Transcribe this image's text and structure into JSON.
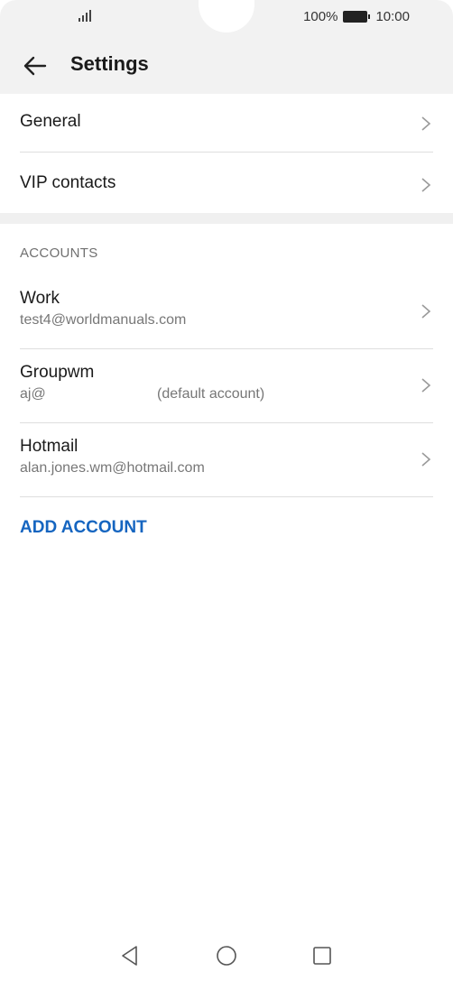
{
  "status": {
    "battery_percent": "100%",
    "time": "10:00"
  },
  "appbar": {
    "title": "Settings"
  },
  "menu": [
    {
      "label": "General"
    },
    {
      "label": "VIP contacts"
    }
  ],
  "accounts_header": "ACCOUNTS",
  "accounts": [
    {
      "name": "Work",
      "email": "test4@worldmanuals.com",
      "note": ""
    },
    {
      "name": "Groupwm",
      "email": "aj@",
      "note": "(default account)"
    },
    {
      "name": "Hotmail",
      "email": "alan.jones.wm@hotmail.com",
      "note": ""
    }
  ],
  "add_account_label": "ADD ACCOUNT",
  "colors": {
    "accent": "#1565c0",
    "header_bg": "#f2f2f2"
  },
  "icons": [
    "signal-icon",
    "battery-icon",
    "back-arrow-icon",
    "chevron-right-icon",
    "nav-back-icon",
    "nav-home-icon",
    "nav-recents-icon"
  ]
}
